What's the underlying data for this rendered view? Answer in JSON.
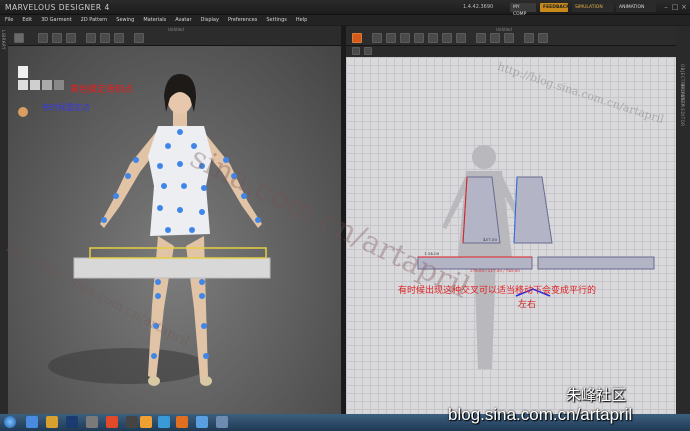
{
  "app": {
    "logo": "MARVELOUS DESIGNER 4",
    "version": "1.4.42.3690",
    "account_label": "MY COMP",
    "feedback_label": "FEEDBACK",
    "simulation_label": "SIMULATION",
    "animation_label": "ANIMATION"
  },
  "menu": [
    "File",
    "Edit",
    "3D Garment",
    "2D Pattern",
    "Sewing",
    "Materials",
    "Avatar",
    "Display",
    "Preferences",
    "Settings",
    "Help"
  ],
  "left_pane": {
    "label": "Untitled",
    "side_label": "LIBRARY"
  },
  "right_pane": {
    "label": "Untitled",
    "side_labels": [
      "OBJECT BROWSER",
      "PROPERTY EDITOR"
    ]
  },
  "annotations": {
    "red_top": "黄色模定骨刺点",
    "blue_top": "有时候重定点",
    "red_bottom": "有时候出现这种交叉可以适当移动下会变成平行的",
    "blue_bottom": "左右"
  },
  "pattern_dimensions": {
    "front": "457.50",
    "back": "457.50",
    "strip_left": "1 54.00",
    "strip_total": "278.00 / 217.00 / 749.00"
  },
  "watermarks": {
    "right_top": "http://blog.sina.com.cn/artapril",
    "left_diag": "http://blog.sina.com.cn/artapril",
    "center_diag": "sina.com.cn/artapril",
    "corner_cn": "朱峰社区",
    "corner_en": "blog.sina.com.cn/artapril"
  },
  "colors": {
    "accent": "#c98a1c",
    "pattern_fill": "#b3b4c6",
    "annotation_red": "#e02020",
    "annotation_blue": "#3a3ae0",
    "pin_blue": "#3f86e8"
  },
  "taskbar": {
    "icons": [
      "start-icon",
      "ie-icon",
      "chrome-icon",
      "explorer-icon",
      "photoshop-icon",
      "files-icon",
      "chrome2-icon",
      "media-icon",
      "gmail-icon",
      "globe-icon",
      "firefox-icon",
      "folder-icon",
      "cloud-icon",
      "app-icon"
    ]
  }
}
